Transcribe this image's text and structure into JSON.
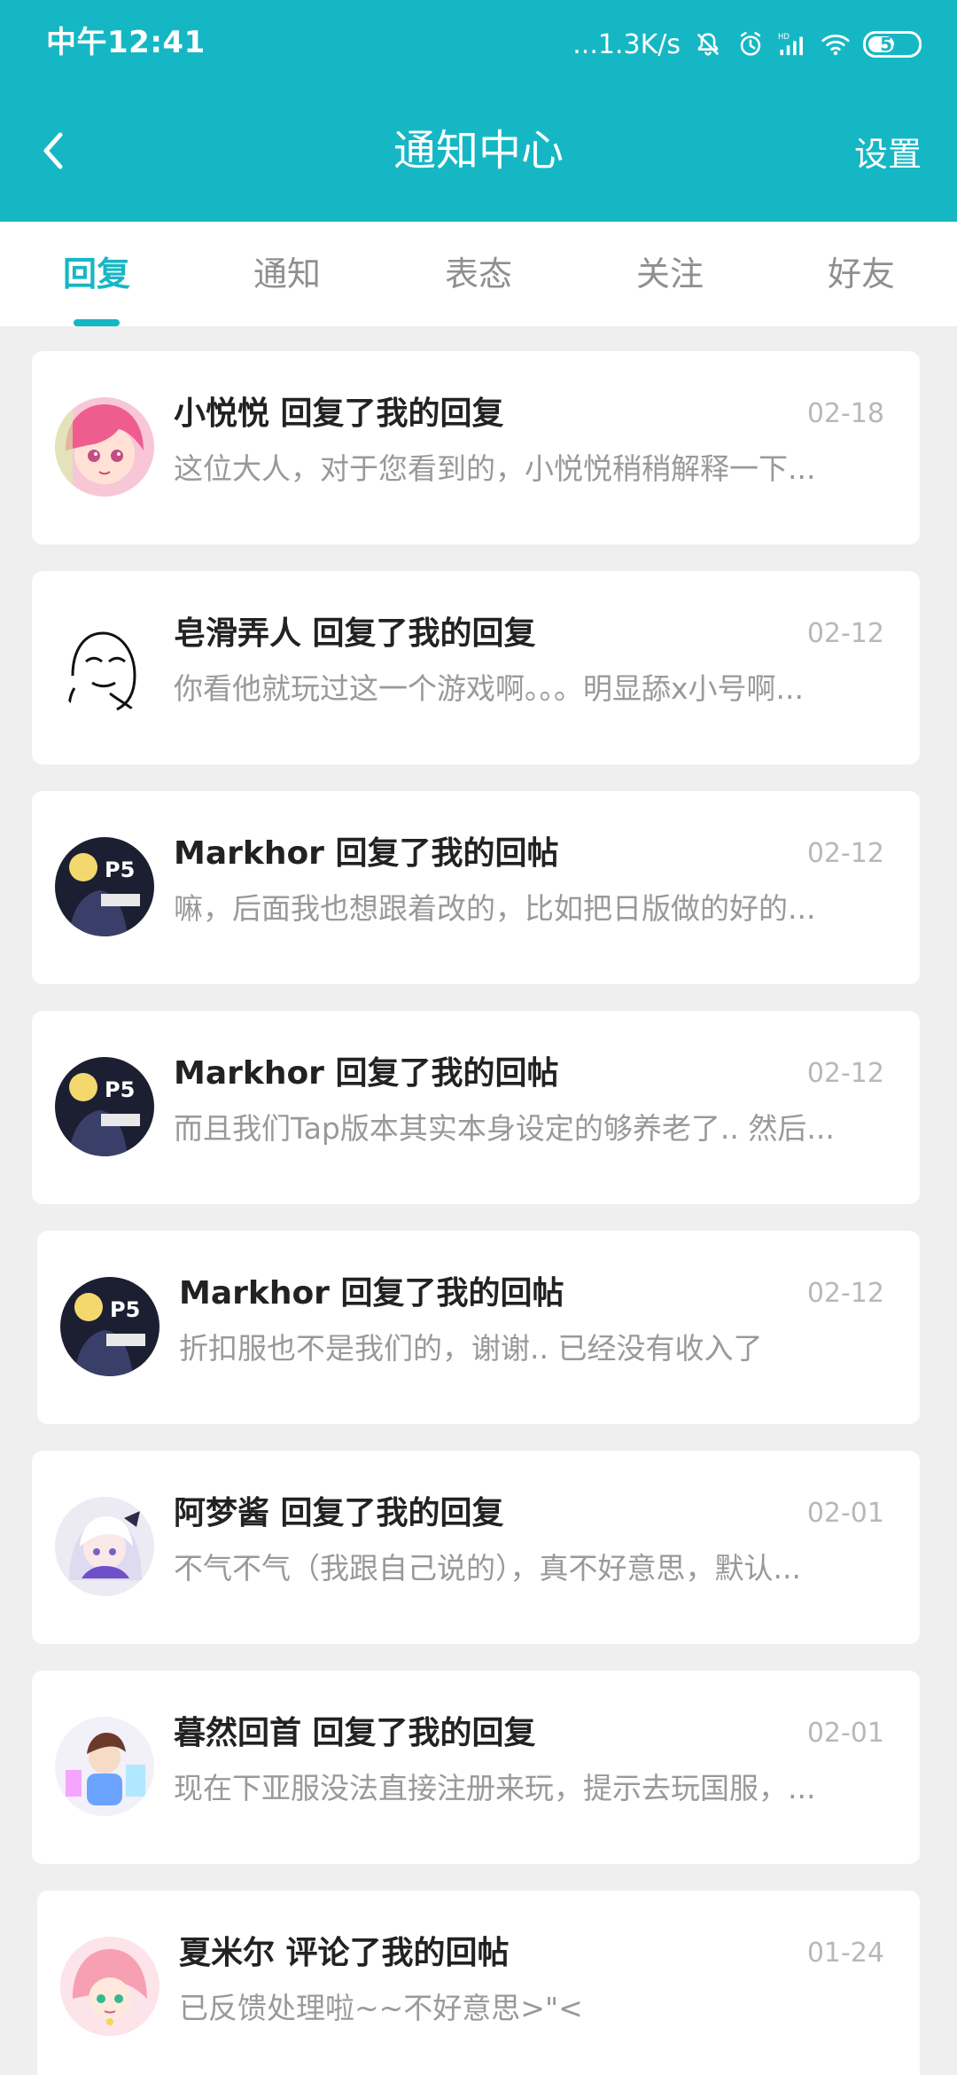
{
  "status_bar": {
    "time": "中午12:41",
    "network_speed": "...1.3K/s",
    "battery_level": "58",
    "icons": [
      "mute-icon",
      "alarm-icon",
      "signal-icon",
      "wifi-icon",
      "battery-icon"
    ]
  },
  "header": {
    "back_icon": "back-icon",
    "title": "通知中心",
    "settings_label": "设置"
  },
  "tabs": [
    {
      "label": "回复",
      "active": true
    },
    {
      "label": "通知",
      "active": false
    },
    {
      "label": "表态",
      "active": false
    },
    {
      "label": "关注",
      "active": false
    },
    {
      "label": "好友",
      "active": false
    }
  ],
  "notifications": [
    {
      "title": "小悦悦 回复了我的回复",
      "date": "02-18",
      "snippet": "这位大人，对于您看到的，小悦悦稍稍解释一下...",
      "avatar": "anime-avatar-pink-hair"
    },
    {
      "title": "皂滑弄人 回复了我的回复",
      "date": "02-12",
      "snippet": "你看他就玩过这一个游戏啊。。。明显舔x小号啊...",
      "avatar": "meme-face-avatar"
    },
    {
      "title": "Markhor 回复了我的回帖",
      "date": "02-12",
      "snippet": "嘛，后面我也想跟着改的，比如把日版做的好的...",
      "avatar": "persona-avatar"
    },
    {
      "title": "Markhor 回复了我的回帖",
      "date": "02-12",
      "snippet": "而且我们Tap版本其实本身设定的够养老了.. 然后...",
      "avatar": "persona-avatar"
    },
    {
      "title": "Markhor 回复了我的回帖",
      "date": "02-12",
      "snippet": "折扣服也不是我们的，谢谢.. 已经没有收入了",
      "avatar": "persona-avatar"
    },
    {
      "title": "阿梦酱 回复了我的回复",
      "date": "02-01",
      "snippet": "不气不气（我跟自己说的），真不好意思，默认...",
      "avatar": "anime-avatar-white-hair"
    },
    {
      "title": "暮然回首 回复了我的回复",
      "date": "02-01",
      "snippet": "现在下亚服没法直接注册来玩，提示去玩国服，...",
      "avatar": "anime-avatar-boy"
    },
    {
      "title": "夏米尔 评论了我的回帖",
      "date": "01-24",
      "snippet": "已反馈处理啦~~不好意思>\"<",
      "avatar": "anime-avatar-green-eyes"
    }
  ]
}
